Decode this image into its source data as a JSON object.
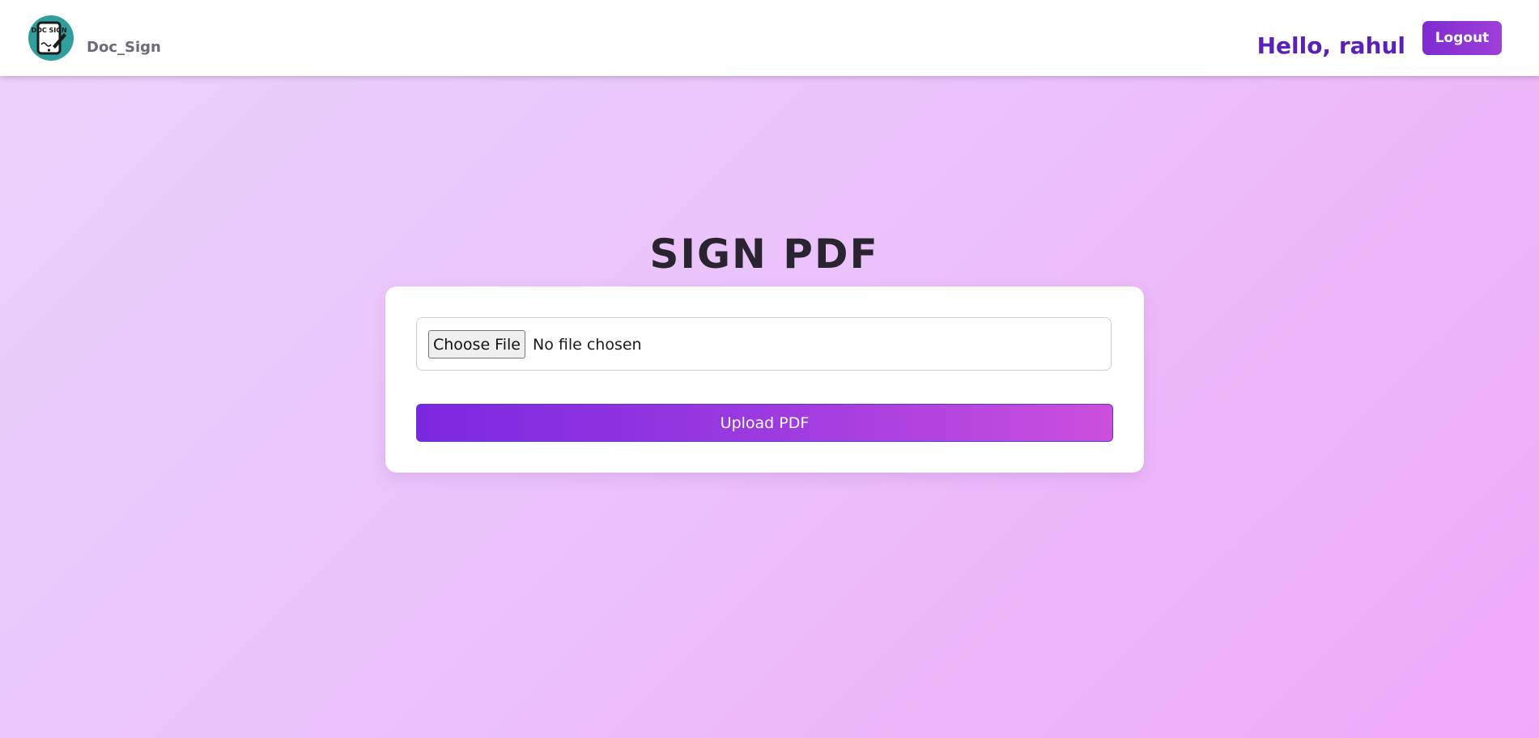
{
  "header": {
    "logo_icon": "doc-sign-logo-icon",
    "logo_text": "DOC SIGN",
    "brand": "Doc_Sign",
    "greeting": "Hello, rahul",
    "logout_label": "Logout"
  },
  "main": {
    "title": "SIGN PDF",
    "file_input": {
      "button_label": "Choose File",
      "status": "No file chosen"
    },
    "upload_label": "Upload PDF"
  },
  "colors": {
    "accent": "#8a32d8",
    "greeting": "#5b21b6",
    "logo_bg": "#2f9e9c"
  }
}
